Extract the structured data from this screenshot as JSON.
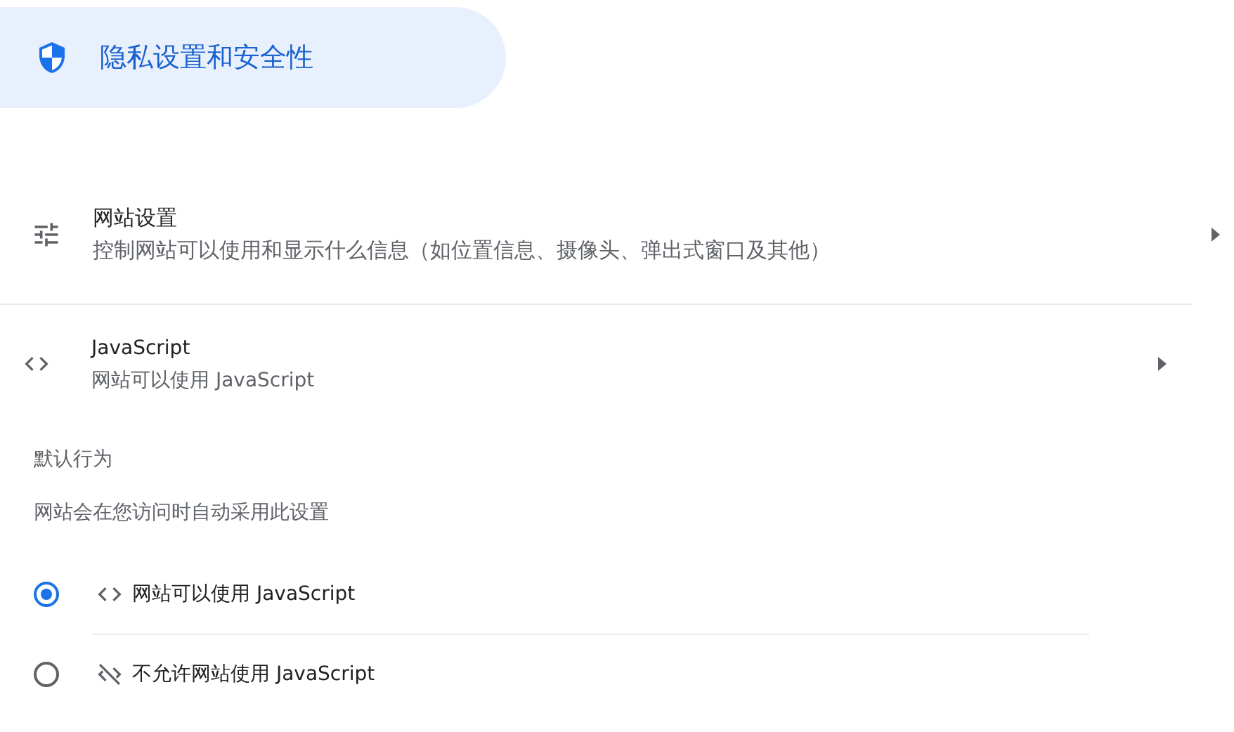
{
  "header": {
    "title": "隐私设置和安全性"
  },
  "site_settings": {
    "title": "网站设置",
    "subtitle": "控制网站可以使用和显示什么信息（如位置信息、摄像头、弹出式窗口及其他）"
  },
  "javascript": {
    "title": "JavaScript",
    "subtitle": "网站可以使用 JavaScript"
  },
  "default_behavior": {
    "heading": "默认行为",
    "description": "网站会在您访问时自动采用此设置",
    "options": [
      {
        "label": "网站可以使用 JavaScript",
        "selected": true
      },
      {
        "label": "不允许网站使用 JavaScript",
        "selected": false
      }
    ]
  }
}
